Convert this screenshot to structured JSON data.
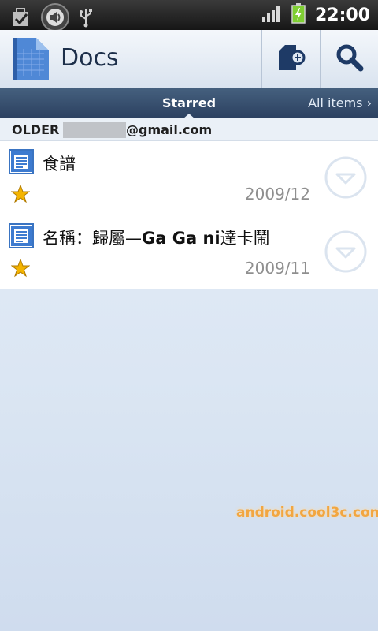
{
  "status_bar": {
    "time": "22:00",
    "icons": [
      "task-check-icon",
      "volume-notification-icon",
      "usb-icon",
      "signal-icon",
      "battery-charging-icon"
    ]
  },
  "action_bar": {
    "title": "Docs",
    "icons": [
      "docs-app-icon",
      "new-document-icon",
      "search-icon"
    ]
  },
  "tabs": {
    "active": "Starred",
    "other": "All items ›"
  },
  "section": {
    "prefix": "OLDER - ",
    "email_suffix": "@gmail.com"
  },
  "documents": [
    {
      "title": "食譜",
      "date": "2009/12",
      "starred": true
    },
    {
      "title_prefix": "名稱：歸屬—",
      "title_bold": "Ga Ga ni",
      "title_suffix": "達卡鬧",
      "date": "2009/11",
      "starred": true
    }
  ],
  "watermark": "android.cool3c.com",
  "colors": {
    "tab_bar": "#2b4060",
    "title_text": "#1d2f4a",
    "star": "#f4b400",
    "watermark": "#f2a640"
  }
}
